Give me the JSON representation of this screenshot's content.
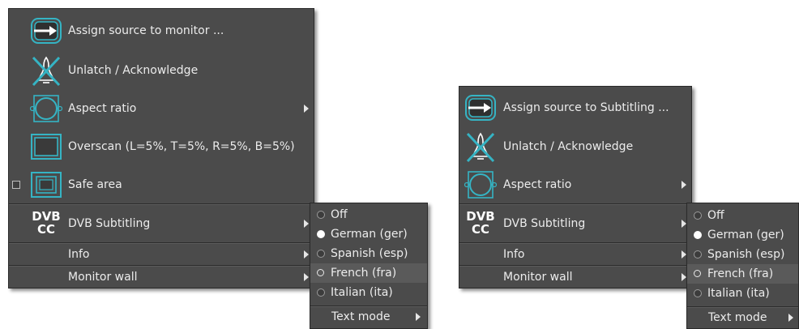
{
  "left_menu": {
    "items": [
      {
        "icon": "assign-arrow-icon",
        "label": "Assign source to monitor ..."
      },
      {
        "icon": "unlatch-bell-icon",
        "label": "Unlatch / Acknowledge"
      },
      {
        "icon": "aspect-ratio-icon",
        "label": "Aspect ratio"
      },
      {
        "icon": "overscan-icon",
        "label": "Overscan (L=5%, T=5%, R=5%, B=5%)"
      },
      {
        "icon": "safe-area-icon",
        "label": "Safe area",
        "checked": false
      },
      {
        "icon": "dvb-cc-icon",
        "label": "DVB Subtitling",
        "icon_text_top": "DVB",
        "icon_text_bottom": "CC"
      },
      {
        "label": "Info"
      },
      {
        "label": "Monitor wall"
      }
    ],
    "submenu": {
      "options": [
        {
          "label": "Off",
          "selected": false
        },
        {
          "label": "German (ger)",
          "selected": true
        },
        {
          "label": "Spanish (esp)",
          "selected": false
        },
        {
          "label": "French (fra)",
          "selected": false
        },
        {
          "label": "Italian (ita)",
          "selected": false
        }
      ],
      "text_mode": "Text mode"
    }
  },
  "right_menu": {
    "items": [
      {
        "icon": "assign-arrow-icon",
        "label": "Assign source to Subtitling ..."
      },
      {
        "icon": "unlatch-bell-icon",
        "label": "Unlatch / Acknowledge"
      },
      {
        "icon": "aspect-ratio-icon",
        "label": "Aspect ratio"
      },
      {
        "icon": "dvb-cc-icon",
        "label": "DVB Subtitling",
        "icon_text_top": "DVB",
        "icon_text_bottom": "CC"
      },
      {
        "label": "Info"
      },
      {
        "label": "Monitor wall"
      }
    ],
    "submenu": {
      "options": [
        {
          "label": "Off",
          "selected": false
        },
        {
          "label": "German (ger)",
          "selected": true
        },
        {
          "label": "Spanish (esp)",
          "selected": false
        },
        {
          "label": "French (fra)",
          "selected": false
        },
        {
          "label": "Italian (ita)",
          "selected": false
        }
      ],
      "text_mode": "Text mode"
    }
  },
  "colors": {
    "menu_bg": "#4b4b4b",
    "icon_cyan": "#35b4c4",
    "text": "#ececec"
  }
}
